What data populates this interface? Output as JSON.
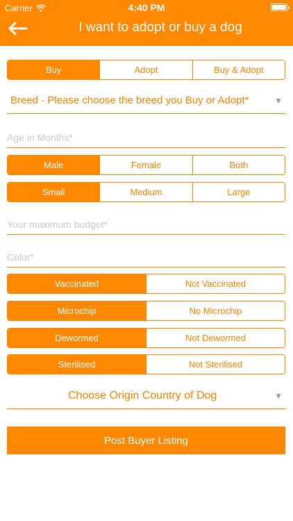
{
  "status_bar": {
    "carrier": "Carrier",
    "time": "4:40 PM"
  },
  "nav": {
    "title": "I want to adopt or buy a dog"
  },
  "listing_type": {
    "options": [
      "Buy",
      "Adopt",
      "Buy & Adopt"
    ],
    "selected": "Buy"
  },
  "breed": {
    "label": "Breed - Please choose the breed you Buy or Adopt*"
  },
  "age": {
    "placeholder": "Age in Months*",
    "value": ""
  },
  "gender": {
    "options": [
      "Male",
      "Female",
      "Both"
    ],
    "selected": "Male"
  },
  "size": {
    "options": [
      "Small",
      "Medium",
      "Large"
    ],
    "selected": "Small"
  },
  "budget": {
    "placeholder": "Your maximum budget*",
    "value": ""
  },
  "color": {
    "placeholder": "Color*",
    "value": ""
  },
  "vaccinated": {
    "options": [
      "Vaccinated",
      "Not Vaccinated"
    ],
    "selected": "Vaccinated"
  },
  "microchip": {
    "options": [
      "Microchip",
      "No Microchip"
    ],
    "selected": "Microchip"
  },
  "dewormed": {
    "options": [
      "Dewormed",
      "Not Dewormed"
    ],
    "selected": "Dewormed"
  },
  "sterilised": {
    "options": [
      "Sterilised",
      "Not Sterilised"
    ],
    "selected": "Sterilised"
  },
  "origin": {
    "label": "Choose Origin Country of Dog"
  },
  "submit": {
    "label": "Post Buyer Listing"
  },
  "colors": {
    "brand": "#ff8800",
    "text_accent": "#f08300",
    "placeholder": "#c8c8c8"
  }
}
